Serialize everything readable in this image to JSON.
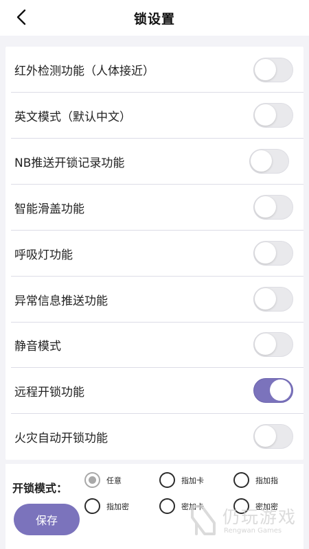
{
  "header": {
    "title": "锁设置"
  },
  "settings": [
    {
      "label": "红外检测功能（人体接近）",
      "on": false
    },
    {
      "label": "英文模式（默认中文）",
      "on": false
    },
    {
      "label": "NB推送开锁记录功能",
      "on": false
    },
    {
      "label": "智能滑盖功能",
      "on": false
    },
    {
      "label": "呼吸灯功能",
      "on": false
    },
    {
      "label": "异常信息推送功能",
      "on": false
    },
    {
      "label": "静音模式",
      "on": false
    },
    {
      "label": "远程开锁功能",
      "on": true
    },
    {
      "label": "火灾自动开锁功能",
      "on": false
    }
  ],
  "unlock_mode": {
    "label": "开锁模式：",
    "options": [
      "任意",
      "指加卡",
      "指加指",
      "指加密",
      "密加卡",
      "密加密"
    ],
    "selected": "任意"
  },
  "save_label": "保存",
  "watermark": {
    "brand": "仍玩游戏",
    "sub": "Rengwan Games"
  },
  "colors": {
    "accent": "#7b73bc",
    "background": "#f3f3f7",
    "toggle_off": "#e9e9ec"
  }
}
